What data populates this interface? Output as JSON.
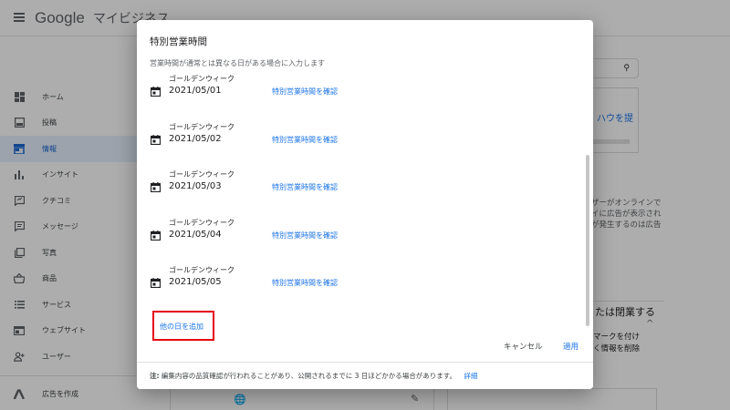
{
  "app": {
    "brand_google": "Google",
    "brand_product": "マイビジネス"
  },
  "sidebar": {
    "items": [
      {
        "label": "ホーム"
      },
      {
        "label": "投稿"
      },
      {
        "label": "情報"
      },
      {
        "label": "インサイト"
      },
      {
        "label": "クチコミ"
      },
      {
        "label": "メッセージ"
      },
      {
        "label": "写真"
      },
      {
        "label": "商品"
      },
      {
        "label": "サービス"
      },
      {
        "label": "ウェブサイト"
      },
      {
        "label": "ユーザー"
      },
      {
        "label": "広告を作成"
      }
    ]
  },
  "background": {
    "card_title": "ハウを提",
    "side_text": [
      "ザーがオンラインで",
      "イに広告が表示され",
      "が発生するのは広告"
    ],
    "heading": "たは閉業する",
    "small_text": [
      "マークを付け",
      "く情報を削除"
    ]
  },
  "dialog": {
    "title": "特別営業時間",
    "subtitle": "営業時間が通常とは異なる日がある場合に入力します",
    "entries": [
      {
        "name": "ゴールデンウィーク",
        "date": "2021/05/01",
        "link": "特別営業時間を確認"
      },
      {
        "name": "ゴールデンウィーク",
        "date": "2021/05/02",
        "link": "特別営業時間を確認"
      },
      {
        "name": "ゴールデンウィーク",
        "date": "2021/05/03",
        "link": "特別営業時間を確認"
      },
      {
        "name": "ゴールデンウィーク",
        "date": "2021/05/04",
        "link": "特別営業時間を確認"
      },
      {
        "name": "ゴールデンウィーク",
        "date": "2021/05/05",
        "link": "特別営業時間を確認"
      }
    ],
    "add_date_label": "他の日を追加",
    "cancel_label": "キャンセル",
    "apply_label": "適用",
    "footer_note_prefix": "注:",
    "footer_note": "編集内容の品質確認が行われることがあり、公開されるまでに 3 日ほどかかる場合があります。",
    "footer_link": "詳細"
  },
  "colors": {
    "accent": "#1a73e8",
    "highlight_box": "#e60012",
    "scrim": "rgba(0,0,0,0.32)"
  }
}
